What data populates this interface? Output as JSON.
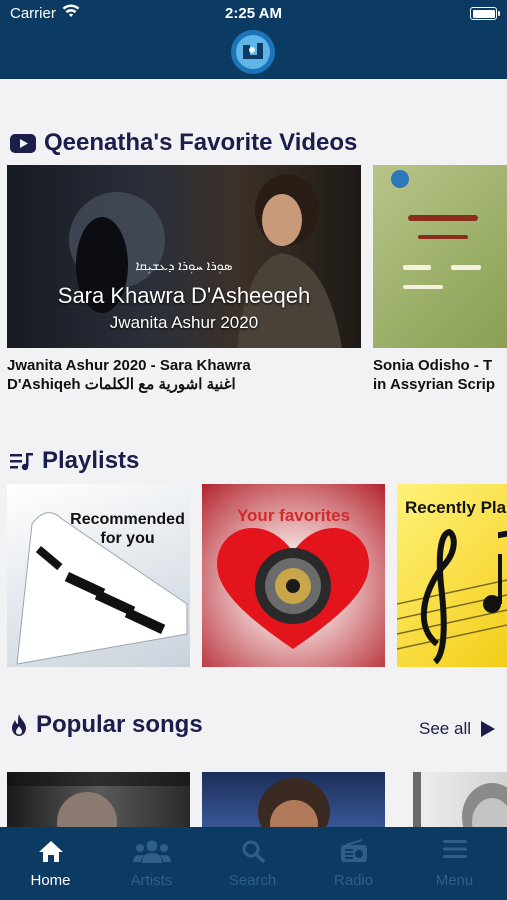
{
  "status": {
    "carrier": "Carrier",
    "time": "2:25 AM"
  },
  "videos": {
    "title": "Qeenatha's Favorite Videos",
    "items": [
      {
        "thumb_title": "Sara Khawra D'Asheeqeh",
        "thumb_sub": "Jwanita Ashur 2020",
        "script_line": "ܣܘܼܪܐ ܚܘܼܪܐ ܕܥܫܝܼܩܐ",
        "caption1": "Jwanita Ashur 2020 - Sara Khawra",
        "caption2": "D'Ashiqeh اغنية اشورية مع الكلمات"
      },
      {
        "caption1": "Sonia Odisho - T",
        "caption2": "in Assyrian Scrip"
      }
    ]
  },
  "playlists": {
    "title": "Playlists",
    "items": [
      {
        "label": "Recommended for you"
      },
      {
        "label": "Your favorites"
      },
      {
        "label": "Recently Pla"
      }
    ]
  },
  "popular": {
    "title": "Popular songs",
    "see_all": "See all"
  },
  "tabs": [
    {
      "label": "Home",
      "icon": "home-icon",
      "active": true
    },
    {
      "label": "Artists",
      "icon": "users-icon"
    },
    {
      "label": "Search",
      "icon": "search-icon"
    },
    {
      "label": "Radio",
      "icon": "radio-icon"
    },
    {
      "label": "Menu",
      "icon": "menu-icon"
    }
  ]
}
